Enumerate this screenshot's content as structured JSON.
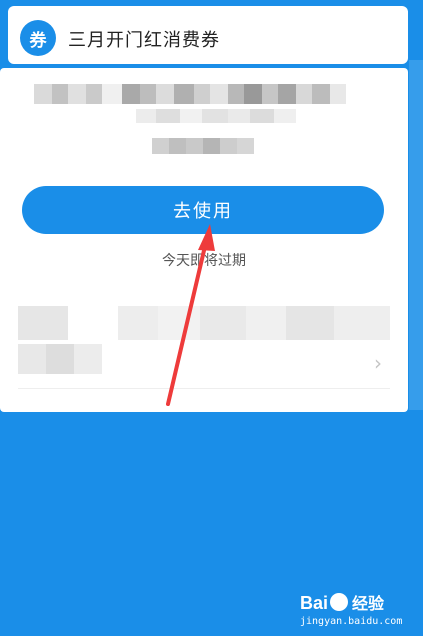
{
  "header": {
    "badge_icon_text": "券",
    "title": "三月开门红消费券"
  },
  "coupon": {
    "use_button_label": "去使用",
    "expiry_text": "今天即将过期",
    "chevron": "›"
  },
  "watermark": {
    "logo_text_left": "Bai",
    "logo_text_right": "经验",
    "url": "jingyan.baidu.com"
  },
  "colors": {
    "background": "#1a8ee8",
    "primary_button": "#1a8ee8",
    "annotation_arrow": "#ee3b3b"
  }
}
